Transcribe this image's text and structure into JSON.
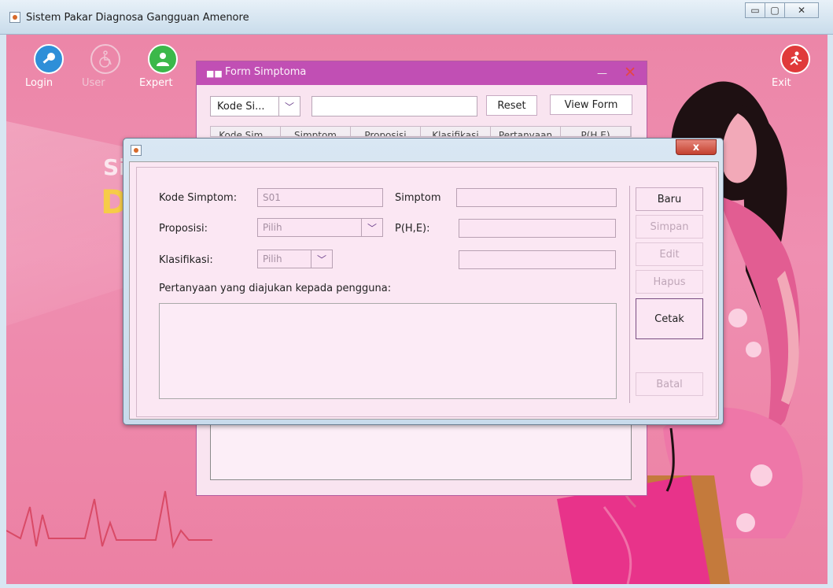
{
  "window": {
    "title": "Sistem Pakar Diagnosa Gangguan Amenore",
    "minimize": "▭",
    "maximize": "▢",
    "close": "✕"
  },
  "toolbar": {
    "login": "Login",
    "user": "User",
    "expert": "Expert",
    "exit": "Exit"
  },
  "background_title": {
    "fragment_1": "Si",
    "fragment_2": "D"
  },
  "form_simptoma": {
    "title": "Form Simptoma",
    "minimize": "—",
    "close": "✕",
    "search_combo": "Kode Si...",
    "search_value": "",
    "reset": "Reset",
    "view_form": "View Form",
    "columns": [
      "Kode Sim...",
      "Simptom",
      "Proposisi",
      "Klasifikasi",
      "Pertanyaan",
      "P(H,E)"
    ]
  },
  "dialog": {
    "close": "x",
    "kode_simptom_label": "Kode Simptom:",
    "kode_simptom_value": "S01",
    "simptom_label": "Simptom",
    "simptom_value": "",
    "proposisi_label": "Proposisi:",
    "proposisi_value": "Pilih",
    "phe_label": "P(H,E):",
    "phe_value": "",
    "klasifikasi_label": "Klasifikasi:",
    "klasifikasi_value": "Pilih",
    "extra_value": "",
    "pertanyaan_label": "Pertanyaan yang diajukan kepada pengguna:",
    "pertanyaan_value": "",
    "buttons": {
      "baru": "Baru",
      "simpan": "Simpan",
      "edit": "Edit",
      "hapus": "Hapus",
      "cetak": "Cetak",
      "batal": "Batal"
    }
  },
  "colors": {
    "desktop_pink": "#ec86a8",
    "frame_purple": "#c14fb4",
    "dialog_panel": "#fbe7f3",
    "accent_yellow": "#f6cc48"
  },
  "icons": {
    "login": "key-icon",
    "user": "wheelchair-icon",
    "expert": "person-icon",
    "exit": "runner-icon"
  }
}
